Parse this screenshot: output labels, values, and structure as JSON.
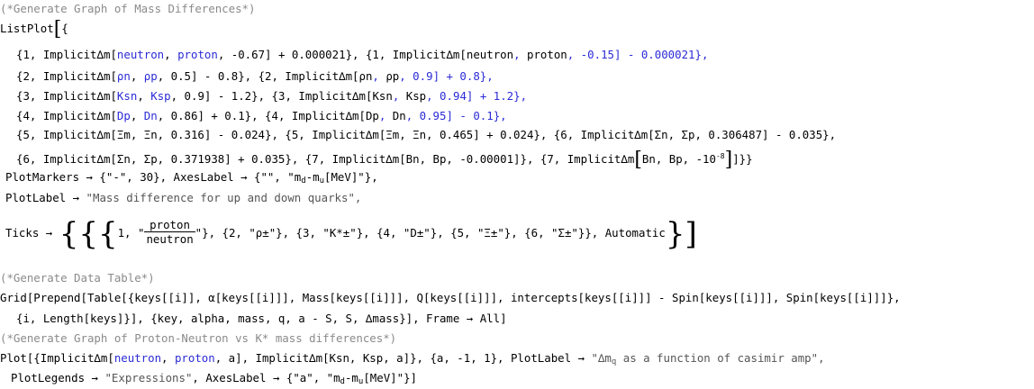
{
  "cell1": {
    "comment": "(*Generate Graph of Mass Differences*)",
    "listplot_open": "ListPlot",
    "rows": [
      [
        "{1, Implicit",
        "∆m",
        "[",
        "neutron",
        ", ",
        "proton",
        ", -0.67] + 0.000021}, {1, Implicit",
        "∆m",
        "[",
        "neutron",
        ", ",
        "proton",
        ", -0.15] - 0.000021},"
      ],
      [
        "{2, Implicit",
        "∆m",
        "[",
        "ρn",
        ", ",
        "ρp",
        ", 0.5] - 0.8}, {2, Implicit",
        "∆m",
        "[",
        "ρn",
        ", ",
        "ρp",
        ", 0.9] + 0.8},"
      ],
      [
        "{3, Implicit",
        "∆m",
        "[",
        "Ksn",
        ", ",
        "Ksp",
        ", 0.9] - 1.2}, {3, Implicit",
        "∆m",
        "[",
        "Ksn",
        ", ",
        "Ksp",
        ", 0.94] + 1.2},"
      ],
      [
        "{4, Implicit",
        "∆m",
        "[",
        "Dp",
        ", ",
        "Dn",
        ", 0.86] + 0.1}, {4, Implicit",
        "∆m",
        "[",
        "Dp",
        ", ",
        "Dn",
        ", 0.95] - 0.1},"
      ]
    ],
    "row5": "{5, Implicit∆m[Ξm, Ξn, 0.316] - 0.024}, {5, Implicit∆m[Ξm, Ξn, 0.465] + 0.024}, {6, Implicit∆m[Σn, Σp, 0.306487] - 0.035},",
    "row6a": "{6, Implicit∆m[Σn, Σp, 0.371938] + 0.035}, {7, Implicit∆m[Bn, Bp, -0.00001]}, {7, Implicit∆m",
    "row6b": "Bn, Bp, -10",
    "row6_exp": "-8",
    "row6_close": "]}}",
    "plotmarkers": "PlotMarkers → {\"-\", 30}, AxesLabel → {\"\", \"m",
    "plotmarkers_d": "d",
    "plotmarkers_mid": "-m",
    "plotmarkers_u": "u",
    "plotmarkers_end": "[MeV]\"},",
    "plotlabel_key": "PlotLabel → ",
    "plotlabel_val": "\"Mass difference for up and down quarks\",",
    "ticks_key": "Ticks → ",
    "frac_num": "proton",
    "frac_den": "neutron",
    "ticks_rest": "\"}, {2, \"ρ±\"}, {3, \"K*±\"}, {4, \"D±\"}, {5, \"Ξ±\"}, {6, \"Σ±\"}}, Automatic"
  },
  "cell2": {
    "comment": "(*Generate Data Table*)",
    "grid_line1": "Grid[Prepend[Table[{keys[[i]], α[keys[[i]]], Mass[keys[[i]]], Q[keys[[i]]], intercepts[keys[[i]]] - Spin[keys[[i]]], Spin[keys[[i]]]},",
    "grid_line2": "{i, Length[keys]}], {key, alpha, mass, q, a - S, S, ∆mass}], Frame → All]"
  },
  "cell3": {
    "comment": "(*Generate Graph of Proton-Neutron vs K* mass differences*)",
    "plot_line1a": "Plot[{Implicit∆m[",
    "plot_line1_neutron": "neutron",
    "plot_line1_sep1": ", ",
    "plot_line1_proton": "proton",
    "plot_line1_b": ", a], Implicit∆m[Ksn, Ksp, a]}, {a, -1, 1}, PlotLabel → ",
    "plot_label_q": "\"∆m",
    "plot_label_sub": "q",
    "plot_label_rest": " as a function of casimir amp\",",
    "legend_line": "PlotLegends → ",
    "legend_val": "\"Expressions\"",
    "axes_line": ", AxesLabel → {\"a\", \"m",
    "axes_d": "d",
    "axes_mid": "-m",
    "axes_u": "u",
    "axes_end": "[MeV]\"}]"
  }
}
